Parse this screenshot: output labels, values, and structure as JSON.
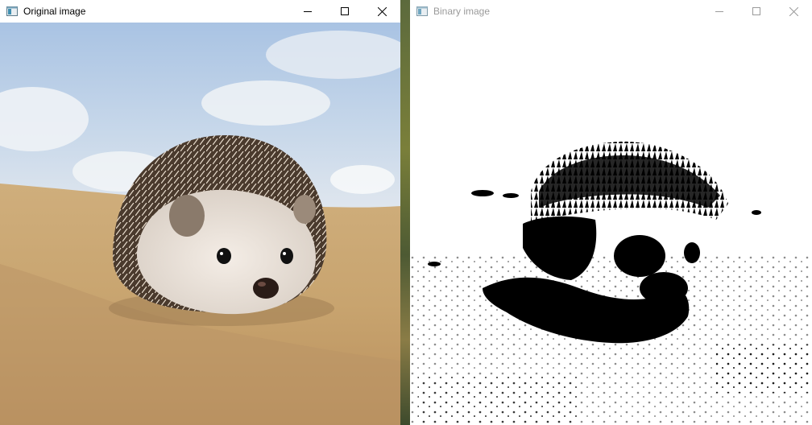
{
  "windows": {
    "original": {
      "title": "Original image",
      "icon": "app-window-icon",
      "controls": [
        "minimize-icon",
        "maximize-icon",
        "close-icon"
      ]
    },
    "binary": {
      "title": "Binary image",
      "icon": "app-window-icon",
      "controls": [
        "minimize-icon",
        "maximize-icon",
        "close-icon"
      ]
    }
  },
  "colors": {
    "title_active": "#000000",
    "title_inactive": "#9a9a9a",
    "sky": "#b9cde6",
    "sand": "#c9a873",
    "quill_dark": "#3a2d22",
    "binary_fg": "#000000",
    "binary_bg": "#ffffff"
  }
}
